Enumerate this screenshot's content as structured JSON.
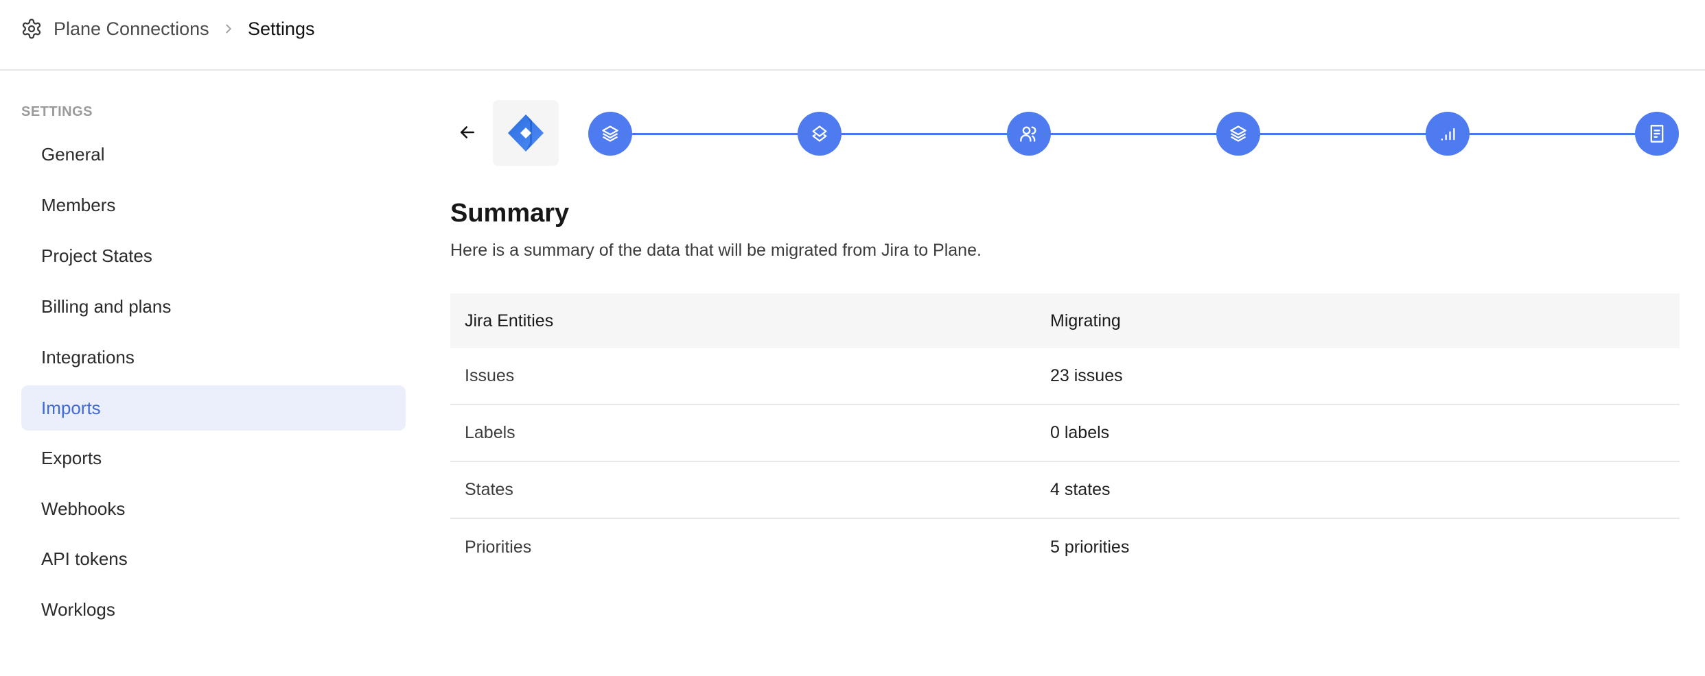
{
  "header": {
    "icon": "gear-icon",
    "breadcrumb": [
      "Plane Connections",
      "Settings"
    ]
  },
  "sidebar": {
    "section_label": "SETTINGS",
    "active_index": 5,
    "items": [
      {
        "label": "General"
      },
      {
        "label": "Members"
      },
      {
        "label": "Project States"
      },
      {
        "label": "Billing and plans"
      },
      {
        "label": "Integrations"
      },
      {
        "label": "Imports"
      },
      {
        "label": "Exports"
      },
      {
        "label": "Webhooks"
      },
      {
        "label": "API tokens"
      },
      {
        "label": "Worklogs"
      }
    ]
  },
  "stepper": {
    "source_logo": "jira-logo",
    "accent_color": "#4f7bf0",
    "steps": [
      {
        "icon": "layers-icon"
      },
      {
        "icon": "layers-two-icon"
      },
      {
        "icon": "users-icon"
      },
      {
        "icon": "layers-icon"
      },
      {
        "icon": "signal-bars-icon"
      },
      {
        "icon": "receipt-icon"
      }
    ],
    "completed_steps": 6,
    "total_steps": 6
  },
  "summary": {
    "title": "Summary",
    "description": "Here is a summary of the data that will be migrated from Jira to Plane.",
    "columns": [
      "Jira Entities",
      "Migrating"
    ],
    "rows": [
      {
        "entity": "Issues",
        "migrating": "23 issues"
      },
      {
        "entity": "Labels",
        "migrating": "0 labels"
      },
      {
        "entity": "States",
        "migrating": "4 states"
      },
      {
        "entity": "Priorities",
        "migrating": "5 priorities"
      }
    ]
  }
}
